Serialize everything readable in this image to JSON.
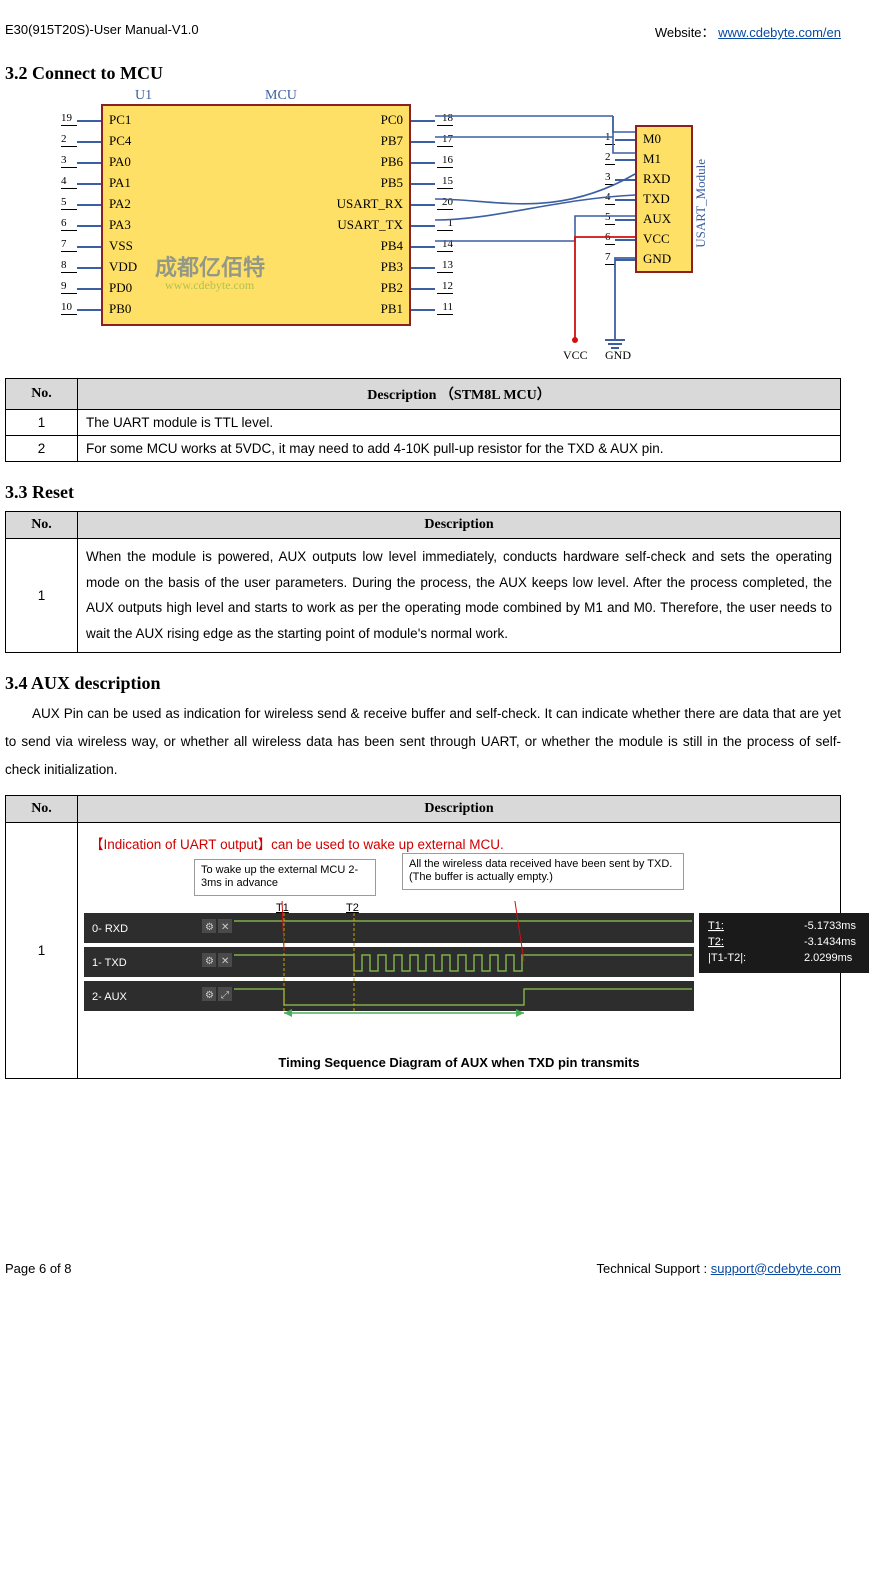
{
  "header": {
    "left": "E30(915T20S)-User Manual-V1.0",
    "right_prefix": "Website： ",
    "right_link": "www.cdebyte.com/en"
  },
  "sections": {
    "s32": "3.2 Connect to MCU",
    "s33": "3.3 Reset",
    "s34": "3.4 AUX description"
  },
  "diagram": {
    "u1": "U1",
    "mcu": "MCU",
    "module": "USART_Module",
    "mcu_left_pins": [
      "PC1",
      "PC4",
      "PA0",
      "PA1",
      "PA2",
      "PA3",
      "VSS",
      "VDD",
      "PD0",
      "PB0"
    ],
    "mcu_left_nums": [
      "19",
      "2",
      "3",
      "4",
      "5",
      "6",
      "7",
      "8",
      "9",
      "10"
    ],
    "mcu_right_pins": [
      "PC0",
      "PB7",
      "PB6",
      "PB5",
      "USART_RX",
      "USART_TX",
      "PB4",
      "PB3",
      "PB2",
      "PB1"
    ],
    "mcu_right_nums": [
      "18",
      "17",
      "16",
      "15",
      "20",
      "1",
      "14",
      "13",
      "12",
      "11"
    ],
    "mod_pins": [
      "M0",
      "M1",
      "RXD",
      "TXD",
      "AUX",
      "VCC",
      "GND"
    ],
    "mod_nums": [
      "1",
      "2",
      "3",
      "4",
      "5",
      "6",
      "7"
    ],
    "watermark_cn": "成都亿佰特",
    "watermark_url": "www.cdebyte.com",
    "vcc": "VCC",
    "gnd": "GND"
  },
  "table1": {
    "h_no": "No.",
    "h_desc": "Description   （STM8L MCU）",
    "rows": [
      {
        "no": "1",
        "desc": "The UART module is TTL level."
      },
      {
        "no": "2",
        "desc": "For some MCU works at 5VDC, it may need to add 4-10K pull-up resistor for the TXD & AUX pin."
      }
    ]
  },
  "table2": {
    "h_no": "No.",
    "h_desc": "Description",
    "rows": [
      {
        "no": "1",
        "desc": "When the module is powered, AUX outputs low level immediately, conducts hardware self-check and sets the operating mode on the basis of the user parameters. During the process, the AUX keeps low level. After the process completed, the AUX outputs high level and starts to work as per the operating mode combined by M1 and M0. Therefore, the user needs to wait the AUX rising edge as the starting point of module's normal work."
      }
    ]
  },
  "aux_body": "AUX Pin can be used as indication for wireless send & receive buffer and self-check. It can indicate whether there are data that are yet to send via wireless way, or whether all wireless data has been sent through UART, or whether the module is still in the process of self-check initialization.",
  "table3": {
    "h_no": "No.",
    "h_desc": "Description",
    "row_no": "1",
    "indication": "【Indication of UART output】can be used to wake up external MCU.",
    "callout1": "To wake up the external MCU 2-3ms in advance",
    "callout2": "All the wireless data received have been sent by TXD.(The buffer is actually empty.)",
    "timing_title": "Timing Sequence Diagram of AUX when TXD pin transmits",
    "scope_rows": [
      "0-  RXD",
      "1-  TXD",
      "2-  AUX"
    ],
    "markers": {
      "t1": "T1",
      "t2": "T2"
    },
    "readouts": [
      {
        "label": "T1:",
        "val": "-5.1733ms"
      },
      {
        "label": "T2:",
        "val": "-3.1434ms"
      },
      {
        "label": "|T1-T2|:",
        "val": "2.0299ms"
      }
    ]
  },
  "footer": {
    "left": "Page   6   of   8",
    "right_prefix": "Technical Support : ",
    "right_link": "support@cdebyte.com"
  }
}
